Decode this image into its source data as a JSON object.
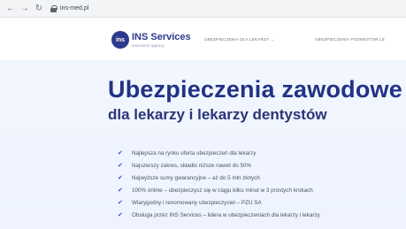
{
  "browser": {
    "back_icon": "←",
    "forward_icon": "→",
    "reload_icon": "↻",
    "url": "ins-med.pl"
  },
  "header": {
    "logo_mark": "ins",
    "logo_name": "INS Services",
    "logo_tagline": "insurance agency",
    "nav": [
      {
        "label": "UBEZPIECZENIA DLA LEKARZY",
        "has_dropdown": true
      },
      {
        "label": "UBEZPIECZENIA PODMIOTÓW LE",
        "has_dropdown": false
      }
    ],
    "chevron": "⌄"
  },
  "hero": {
    "title": "Ubezpieczenia zawodowe",
    "subtitle": "dla lekarzy i lekarzy dentystów",
    "check_icon": "✔",
    "features": [
      "Najlepsza na rynku oferta ubezpieczeń dla lekarzy",
      "Najszerszy zakres, składki niższe nawet do 50%",
      "Najwyższe sumy gwarancyjne – aż do 5 mln złotych",
      "100% online – ubezpieczysz się w ciągu kilku minut w 3 prostych krokach",
      "Wiarygodny i renomowany ubezpieczyciel – PZU SA",
      "Obsługa przez INS Services – lidera w ubezpieczeniach dla lekarzy i lekarzy"
    ]
  },
  "colors": {
    "brand": "#2d3a8c",
    "check": "#2d55c6"
  }
}
